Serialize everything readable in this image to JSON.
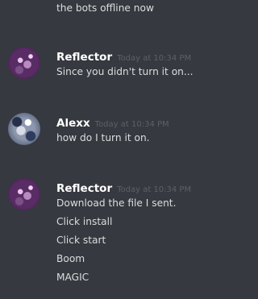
{
  "messages": [
    {
      "lines": [
        "the bots offline now"
      ]
    },
    {
      "author": "Reflector",
      "timestamp": "Today at 10:34 PM",
      "avatar": "reflector-avatar",
      "lines": [
        "Since you didn't turn it on..."
      ]
    },
    {
      "author": "Alexx",
      "timestamp": "Today at 10:34 PM",
      "avatar": "alexx-avatar",
      "lines": [
        "how do I turn it on."
      ]
    },
    {
      "author": "Reflector",
      "timestamp": "Today at 10:34 PM",
      "avatar": "reflector-avatar",
      "lines": [
        "Download the file I sent.",
        "Click install",
        "Click start",
        "Boom",
        "MAGIC"
      ]
    }
  ],
  "colors": {
    "background": "#36393f",
    "text": "#dcddde",
    "author": "#ffffff",
    "timestamp": "#5d6066"
  }
}
